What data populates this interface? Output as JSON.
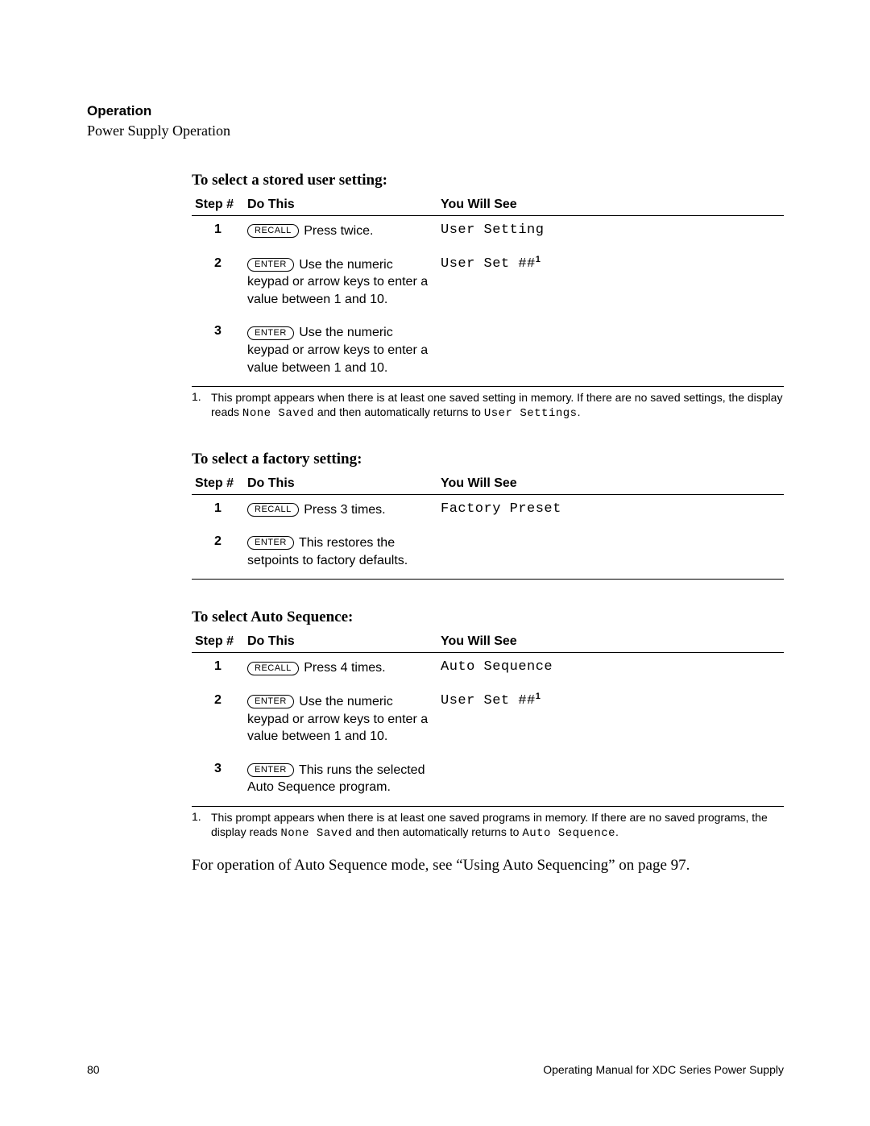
{
  "header": {
    "section": "Operation",
    "subsection": "Power Supply Operation"
  },
  "columns": {
    "step": "Step #",
    "do": "Do This",
    "see": "You Will See"
  },
  "buttons": {
    "recall": "RECALL",
    "enter": "ENTER"
  },
  "section1": {
    "title": "To select a stored user setting:",
    "rows": {
      "r1": {
        "num": "1",
        "do_after": "Press twice.",
        "see": "User Setting"
      },
      "r2": {
        "num": "2",
        "do_after": "Use the numeric keypad or arrow keys to enter a value between 1 and 10.",
        "see": "User Set ##",
        "sup": "1"
      },
      "r3": {
        "num": "3",
        "do_after": "Use the numeric keypad or arrow keys to enter a value between 1 and 10."
      }
    },
    "footnote": {
      "num": "1.",
      "t1": "This prompt appears when there is at least one saved setting in memory. If there are no saved settings, the display reads ",
      "c1": "None Saved",
      "t2": " and then automatically returns to ",
      "c2": "User Settings",
      "t3": "."
    }
  },
  "section2": {
    "title": "To select a factory setting:",
    "rows": {
      "r1": {
        "num": "1",
        "do_after": "Press 3 times.",
        "see": "Factory Preset"
      },
      "r2": {
        "num": "2",
        "do_after": "This restores the setpoints to factory defaults."
      }
    }
  },
  "section3": {
    "title": "To select Auto Sequence:",
    "rows": {
      "r1": {
        "num": "1",
        "do_after": "Press 4 times.",
        "see": "Auto Sequence"
      },
      "r2": {
        "num": "2",
        "do_after": "Use the numeric keypad or arrow keys to enter a value between 1 and 10.",
        "see": "User Set ##",
        "sup": "1"
      },
      "r3": {
        "num": "3",
        "do_after": "This runs the selected Auto Sequence program."
      }
    },
    "footnote": {
      "num": "1.",
      "t1": "This prompt appears when there is at least one saved programs in memory. If there are no saved programs, the display reads ",
      "c1": "None Saved",
      "t2": " and then automatically returns to ",
      "c2": "Auto Sequence",
      "t3": "."
    }
  },
  "closing": "For operation of Auto Sequence mode, see “Using Auto Sequencing” on page 97.",
  "footer": {
    "page": "80",
    "manual": "Operating Manual for XDC Series Power Supply"
  }
}
